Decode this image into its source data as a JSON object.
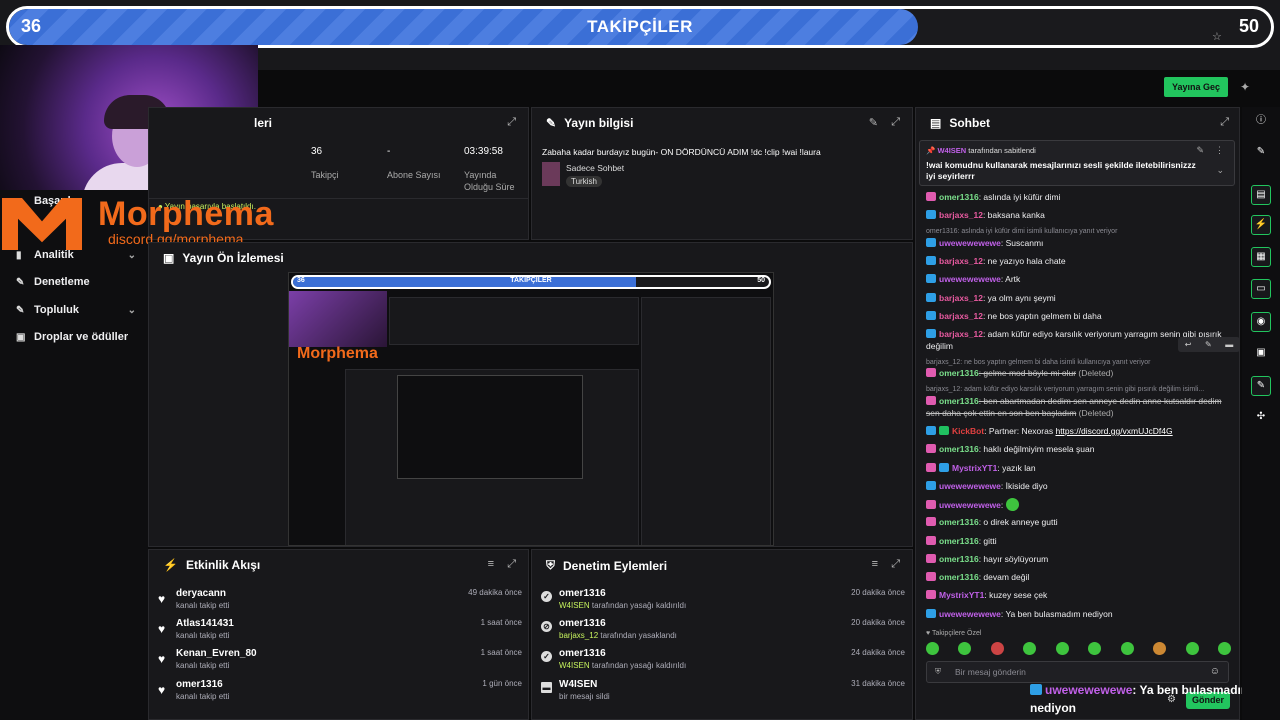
{
  "goal": {
    "current": "36",
    "target": "50",
    "title": "TAKİPÇİLER",
    "progress": 0.72
  },
  "logo": {
    "name": "Morphema",
    "discord": "discord.gg/morphema"
  },
  "toast": "Yayın başarıyla başlatıldı.",
  "sidebar": {
    "items": [
      {
        "label": "Başarılar"
      },
      {
        "label": "Analitik"
      },
      {
        "label": "Denetleme"
      },
      {
        "label": "Topluluk"
      },
      {
        "label": "Droplar ve ödüller"
      }
    ]
  },
  "top_actions": {
    "go_live": "Yayına Geç"
  },
  "stats_panel": {
    "title_fragment": "leri",
    "stats": [
      {
        "value": "36",
        "label": "Takipçi"
      },
      {
        "value": "-",
        "label": "Abone Sayısı"
      },
      {
        "value": "03:39:58",
        "label": "Yayında Olduğu Süre"
      }
    ]
  },
  "stream_info": {
    "title": "Yayın bilgisi",
    "stream_title": "Zabaha kadar burdayız bugün- ON DÖRDÜNCÜ ADIM !dc !clip !wai !laura",
    "category": "Sadece Sohbet",
    "tag": "Turkish"
  },
  "preview": {
    "title": "Yayın Ön İzlemesi",
    "goal_title": "TAKİPÇİLER",
    "goal_current": "36",
    "goal_target": "50",
    "logo": "Morphema"
  },
  "activity": {
    "title": "Etkinlik Akışı",
    "items": [
      {
        "name": "deryacann",
        "sub": "kanalı takip etti",
        "time": "49 dakika önce"
      },
      {
        "name": "Atlas141431",
        "sub": "kanalı takip etti",
        "time": "1 saat önce"
      },
      {
        "name": "Kenan_Evren_80",
        "sub": "kanalı takip etti",
        "time": "1 saat önce"
      },
      {
        "name": "omer1316",
        "sub": "kanalı takip etti",
        "time": "1 gün önce"
      }
    ]
  },
  "moderation": {
    "title": "Denetim Eylemleri",
    "items": [
      {
        "name": "omer1316",
        "actor": "W4ISEN",
        "action": "tarafından yasağı kaldırıldı",
        "time": "20 dakika önce"
      },
      {
        "name": "omer1316",
        "actor": "barjaxs_12",
        "action": "tarafından yasaklandı",
        "time": "20 dakika önce"
      },
      {
        "name": "omer1316",
        "actor": "W4ISEN",
        "action": "tarafından yasağı kaldırıldı",
        "time": "24 dakika önce"
      },
      {
        "name": "W4ISEN",
        "actor": "",
        "action": "bir mesajı sildi",
        "time": "31 dakika önce"
      }
    ]
  },
  "chat": {
    "title": "Sohbet",
    "pinned_by": "W4ISEN",
    "pinned_by_suffix": "tarafından sabitlendi",
    "pinned_text": "!wai komudnu kullanarak mesajlarınızı sesli şekilde iletebilirisnizzz iyi seyirlerrr",
    "messages": [
      {
        "user": "omer1316",
        "text": ": aslında iyi küfür dimi"
      },
      {
        "user": "barjaxs_12",
        "text": ": baksana kanka"
      },
      {
        "reply": "omer1316: aslında iyi küfür dimi isimli kullanıcıya yanıt veriyor"
      },
      {
        "user": "uwewewewewe",
        "text": ": Suscanmı"
      },
      {
        "user": "barjaxs_12",
        "text": ": ne yazıyo hala chate"
      },
      {
        "user": "uwewewewewe",
        "text": ": Artk"
      },
      {
        "user": "barjaxs_12",
        "text": ": ya olm aynı şeymi"
      },
      {
        "user": "barjaxs_12",
        "text": ": ne bos yaptın gelmem bi daha"
      },
      {
        "user": "barjaxs_12",
        "text": ": adam küfür ediyo karsılık veriyorum yarragım senin gibi pısırık değilim"
      },
      {
        "reply": "barjaxs_12: ne bos yaptın gelmem bi daha isimli kullanıcıya yanıt veriyor"
      },
      {
        "user": "omer1316",
        "text": ": gelme mod böyle mi olur",
        "tag": "(Deleted)"
      },
      {
        "reply": "barjaxs_12: adam küfür ediyo karsılık veriyorum yarragım senin gibi pısırık değilim isimli..."
      },
      {
        "user": "omer1316",
        "text": ": ben abartmadan dedim sen anneye dedin anne kutsaldır dedim sen daha çok ettin en son ben başladım",
        "tag": "(Deleted)"
      },
      {
        "user": "KickBot",
        "text": ": Partner: Nexoras ",
        "link": "https://discord.gg/vxmUJcDf4G"
      },
      {
        "user": "omer1316",
        "text": ": haklı değilmiyim mesela şuan"
      },
      {
        "user": "MystrixYT1",
        "text": ": yazık lan"
      },
      {
        "user": "uwewewewewe",
        "text": ": İkiside diyo"
      },
      {
        "user": "uwewewewewe",
        "text": ":"
      },
      {
        "user": "omer1316",
        "text": ": o direk anneye gutti"
      },
      {
        "user": "omer1316",
        "text": ": gitti"
      },
      {
        "user": "omer1316",
        "text": ": hayır söylüyorum"
      },
      {
        "user": "omer1316",
        "text": ": devam değil"
      },
      {
        "user": "MystrixYT1",
        "text": ": kuzey sese çek"
      },
      {
        "user": "uwewewewewe",
        "text": ": Ya ben bulasmadım nediyon"
      }
    ],
    "emotes_label": "Takipçilere Özel",
    "input_placeholder": "Bir mesaj gönderin",
    "send_label": "Gönder"
  },
  "overlay_message": {
    "user": "uwewewewewe",
    "text": ": Ya ben bulasmadım nediyon"
  },
  "colors": {
    "accent": "#22c55e",
    "goal_bar": "#3b6fd6",
    "brand": "#f26a1b"
  }
}
